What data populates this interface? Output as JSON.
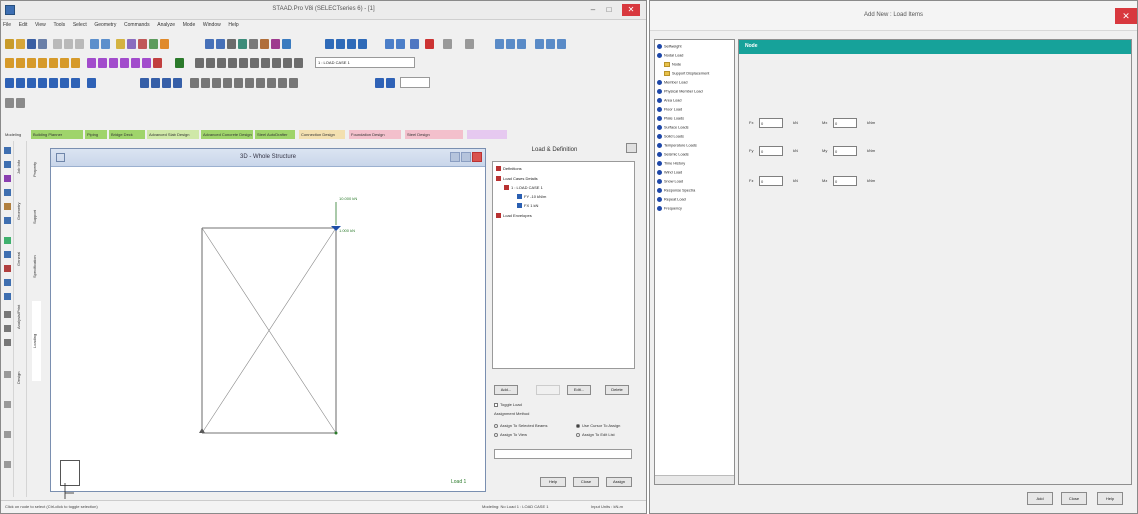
{
  "left_window": {
    "title": "STAAD.Pro V8i (SELECTseries 6) - [1]",
    "menus": [
      "File",
      "Edit",
      "View",
      "Tools",
      "Select",
      "Geometry",
      "Commands",
      "Analyze",
      "Mode",
      "Window",
      "Help"
    ],
    "load_case_dropdown": "1 : LOAD CASE 1",
    "page_tabs": [
      "Modeling",
      "Building Planner",
      "Piping",
      "Bridge Deck",
      "Advanced Slab Design",
      "Advanced Concrete Design",
      "Steel AutoDrafter",
      "Connection Design",
      "Foundation Design",
      "Steel Design"
    ],
    "side_tabs": [
      "Design",
      "Analysis/Print",
      "Loading",
      "Specification",
      "Support",
      "Property",
      "General",
      "Geometry",
      "Job Info"
    ],
    "view": {
      "title": "3D - Whole Structure",
      "load_label_top": "10.000 kN",
      "load_label_bottom": "1.000 kN",
      "active_load": "Load 1"
    },
    "panel": {
      "title": "Load & Definition",
      "tree": [
        {
          "label": "Definitions",
          "level": 0
        },
        {
          "label": "Load Cases Details",
          "level": 0
        },
        {
          "label": "1 : LOAD CASE 1",
          "level": 1
        },
        {
          "label": "FY -10 kN/m",
          "level": 2
        },
        {
          "label": "FX 1 kN",
          "level": 2
        },
        {
          "label": "Load Envelopes",
          "level": 0
        }
      ],
      "buttons": {
        "add": "Add...",
        "edit": "Edit...",
        "delete": "Delete",
        "help": "Help",
        "close": "Close",
        "assign_btn": "Assign"
      },
      "toggle_load": "Toggle Load",
      "assignment_method": "Assignment Method",
      "radios": [
        "Assign To Selected Beams",
        "Assign To View",
        "Use Cursor To Assign",
        "Assign To Edit List"
      ]
    },
    "status_left": "Click on node to select (Ctrl-click to toggle selection)",
    "status_mid": "Modeling: No Load 1 : LOAD CASE 1",
    "status_right": "Input Units : kN-m"
  },
  "right_window": {
    "title": "Add New : Load Items",
    "nav_items": [
      {
        "label": "Selfweight",
        "type": "icon"
      },
      {
        "label": "Nodal Load",
        "type": "icon"
      },
      {
        "label": "Node",
        "type": "folder"
      },
      {
        "label": "Support Displacement",
        "type": "folder"
      },
      {
        "label": "Member Load",
        "type": "icon"
      },
      {
        "label": "Physical Member Load",
        "type": "icon"
      },
      {
        "label": "Area Load",
        "type": "icon"
      },
      {
        "label": "Floor Load",
        "type": "icon"
      },
      {
        "label": "Plate Loads",
        "type": "icon"
      },
      {
        "label": "Surface Loads",
        "type": "icon"
      },
      {
        "label": "Solid Loads",
        "type": "icon"
      },
      {
        "label": "Temperature Loads",
        "type": "icon"
      },
      {
        "label": "Seismic Loads",
        "type": "icon"
      },
      {
        "label": "Time History",
        "type": "icon"
      },
      {
        "label": "Wind Load",
        "type": "icon"
      },
      {
        "label": "Snow Load",
        "type": "icon"
      },
      {
        "label": "Response Spectra",
        "type": "icon"
      },
      {
        "label": "Repeat Load",
        "type": "icon"
      },
      {
        "label": "Frequency",
        "type": "icon"
      }
    ],
    "content_header": "Node",
    "fields": [
      {
        "force_label": "Fx",
        "force_value": "0",
        "force_unit": "kN",
        "moment_label": "Mx",
        "moment_value": "0",
        "moment_unit": "kNm"
      },
      {
        "force_label": "Fy",
        "force_value": "0",
        "force_unit": "kN",
        "moment_label": "My",
        "moment_value": "0",
        "moment_unit": "kNm"
      },
      {
        "force_label": "Fz",
        "force_value": "0",
        "force_unit": "kN",
        "moment_label": "Mz",
        "moment_value": "0",
        "moment_unit": "kNm"
      }
    ],
    "buttons": {
      "add": "Add",
      "close": "Close",
      "help": "Help"
    }
  }
}
